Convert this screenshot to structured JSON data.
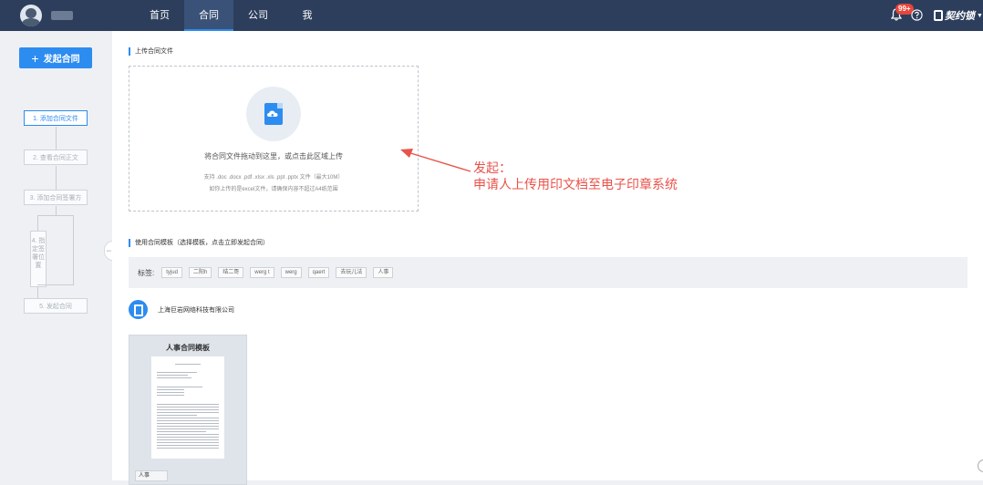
{
  "topbar": {
    "nav": [
      {
        "label": "首页"
      },
      {
        "label": "合同"
      },
      {
        "label": "公司"
      },
      {
        "label": "我"
      }
    ],
    "active_nav": "合同",
    "badge": "99+",
    "brand": "契约锁"
  },
  "sidebar": {
    "start_button": "发起合同",
    "steps": {
      "s1": "1. 添加合同文件",
      "s2": "2. 查看合同正文",
      "s3": "3. 添加合同签署方",
      "s4": "4. 指定签署位置",
      "s5": "5. 发起合同"
    }
  },
  "upload": {
    "section_title": "上传合同文件",
    "drop_text": "将合同文件拖动到这里，或点击此区域上传",
    "formats": "支持 .doc .docx .pdf .xlsx .xls .ppt .pptx 文件（最大10M）",
    "excel_note": "如你上传的是excel文件，请确保内容不超过A4纸范围"
  },
  "annotation": {
    "line1": "发起：",
    "line2": "申请人上传用印文档至电子印章系统"
  },
  "templates": {
    "section_title": "使用合同模板（选择模板，点击立即发起合同）",
    "tag_label": "标签:",
    "tags": [
      "tyjud",
      "二阳h",
      "结二哥",
      "werg t",
      "werg",
      "qaert",
      "去玩儿法",
      "人事"
    ],
    "company": "上海巨岩网络科技有限公司",
    "card_title": "人事合同模板",
    "card_label": "人事"
  },
  "colors": {
    "topbar": "#2c3e5c",
    "accent": "#2d8cf0",
    "annotation": "#e8534a"
  }
}
